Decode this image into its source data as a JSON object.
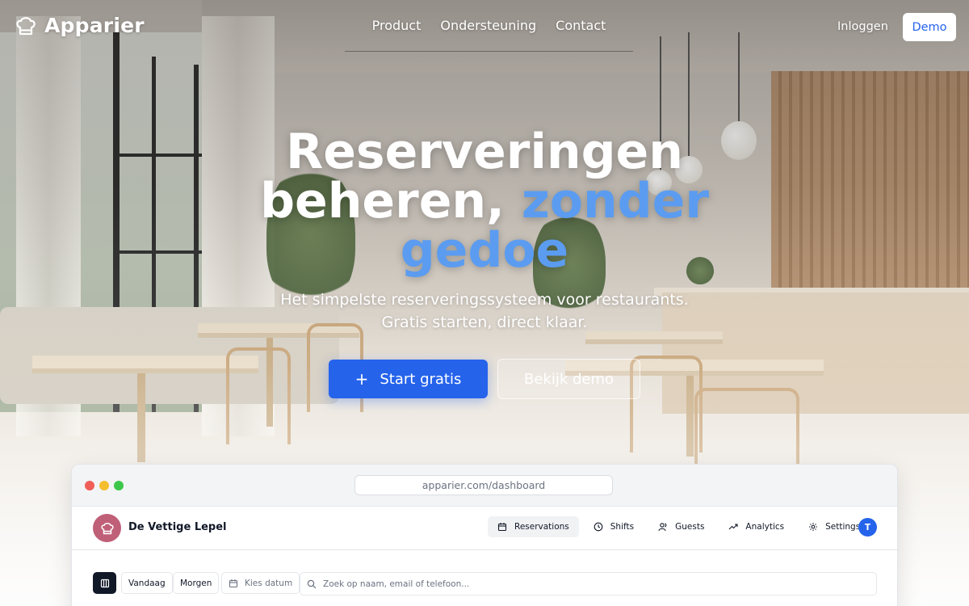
{
  "brand": {
    "name": "Apparier",
    "logo_icon": "chef-hat-icon"
  },
  "nav": {
    "links": [
      "Product",
      "Ondersteuning",
      "Contact"
    ],
    "login_label": "Inloggen",
    "demo_label": "Demo"
  },
  "hero": {
    "title_line1": "Reserveringen",
    "title_line2_plain": "beheren,",
    "title_line2_accent": "zonder",
    "title_line3_accent": "gedoe",
    "subtitle_line1": "Het simpelste reserveringssysteem voor restaurants.",
    "subtitle_line2": "Gratis starten, direct klaar.",
    "cta_primary_icon": "+",
    "cta_primary": "Start gratis",
    "cta_secondary": "Bekijk demo"
  },
  "dashboard": {
    "url": "apparier.com/dashboard",
    "restaurant_name": "De Vettige Lepel",
    "tabs": [
      {
        "label": "Reservations",
        "icon": "calendar-icon",
        "active": true
      },
      {
        "label": "Shifts",
        "icon": "clock-icon",
        "active": false
      },
      {
        "label": "Guests",
        "icon": "users-icon",
        "active": false
      },
      {
        "label": "Analytics",
        "icon": "trend-icon",
        "active": false
      },
      {
        "label": "Settings",
        "icon": "gear-icon",
        "active": false
      }
    ],
    "user_initial": "T",
    "toolbar": {
      "today": "Vandaag",
      "tomorrow": "Morgen",
      "pick_date": "Kies datum",
      "search_placeholder": "Zoek op naam, email of telefoon..."
    }
  },
  "colors": {
    "accent": "#2563eb",
    "accent_light": "#5b9cf0",
    "logo_circle": "#c05f78",
    "traffic_red": "#ef5f58",
    "traffic_yellow": "#f5be2f",
    "traffic_green": "#3dc74a"
  }
}
